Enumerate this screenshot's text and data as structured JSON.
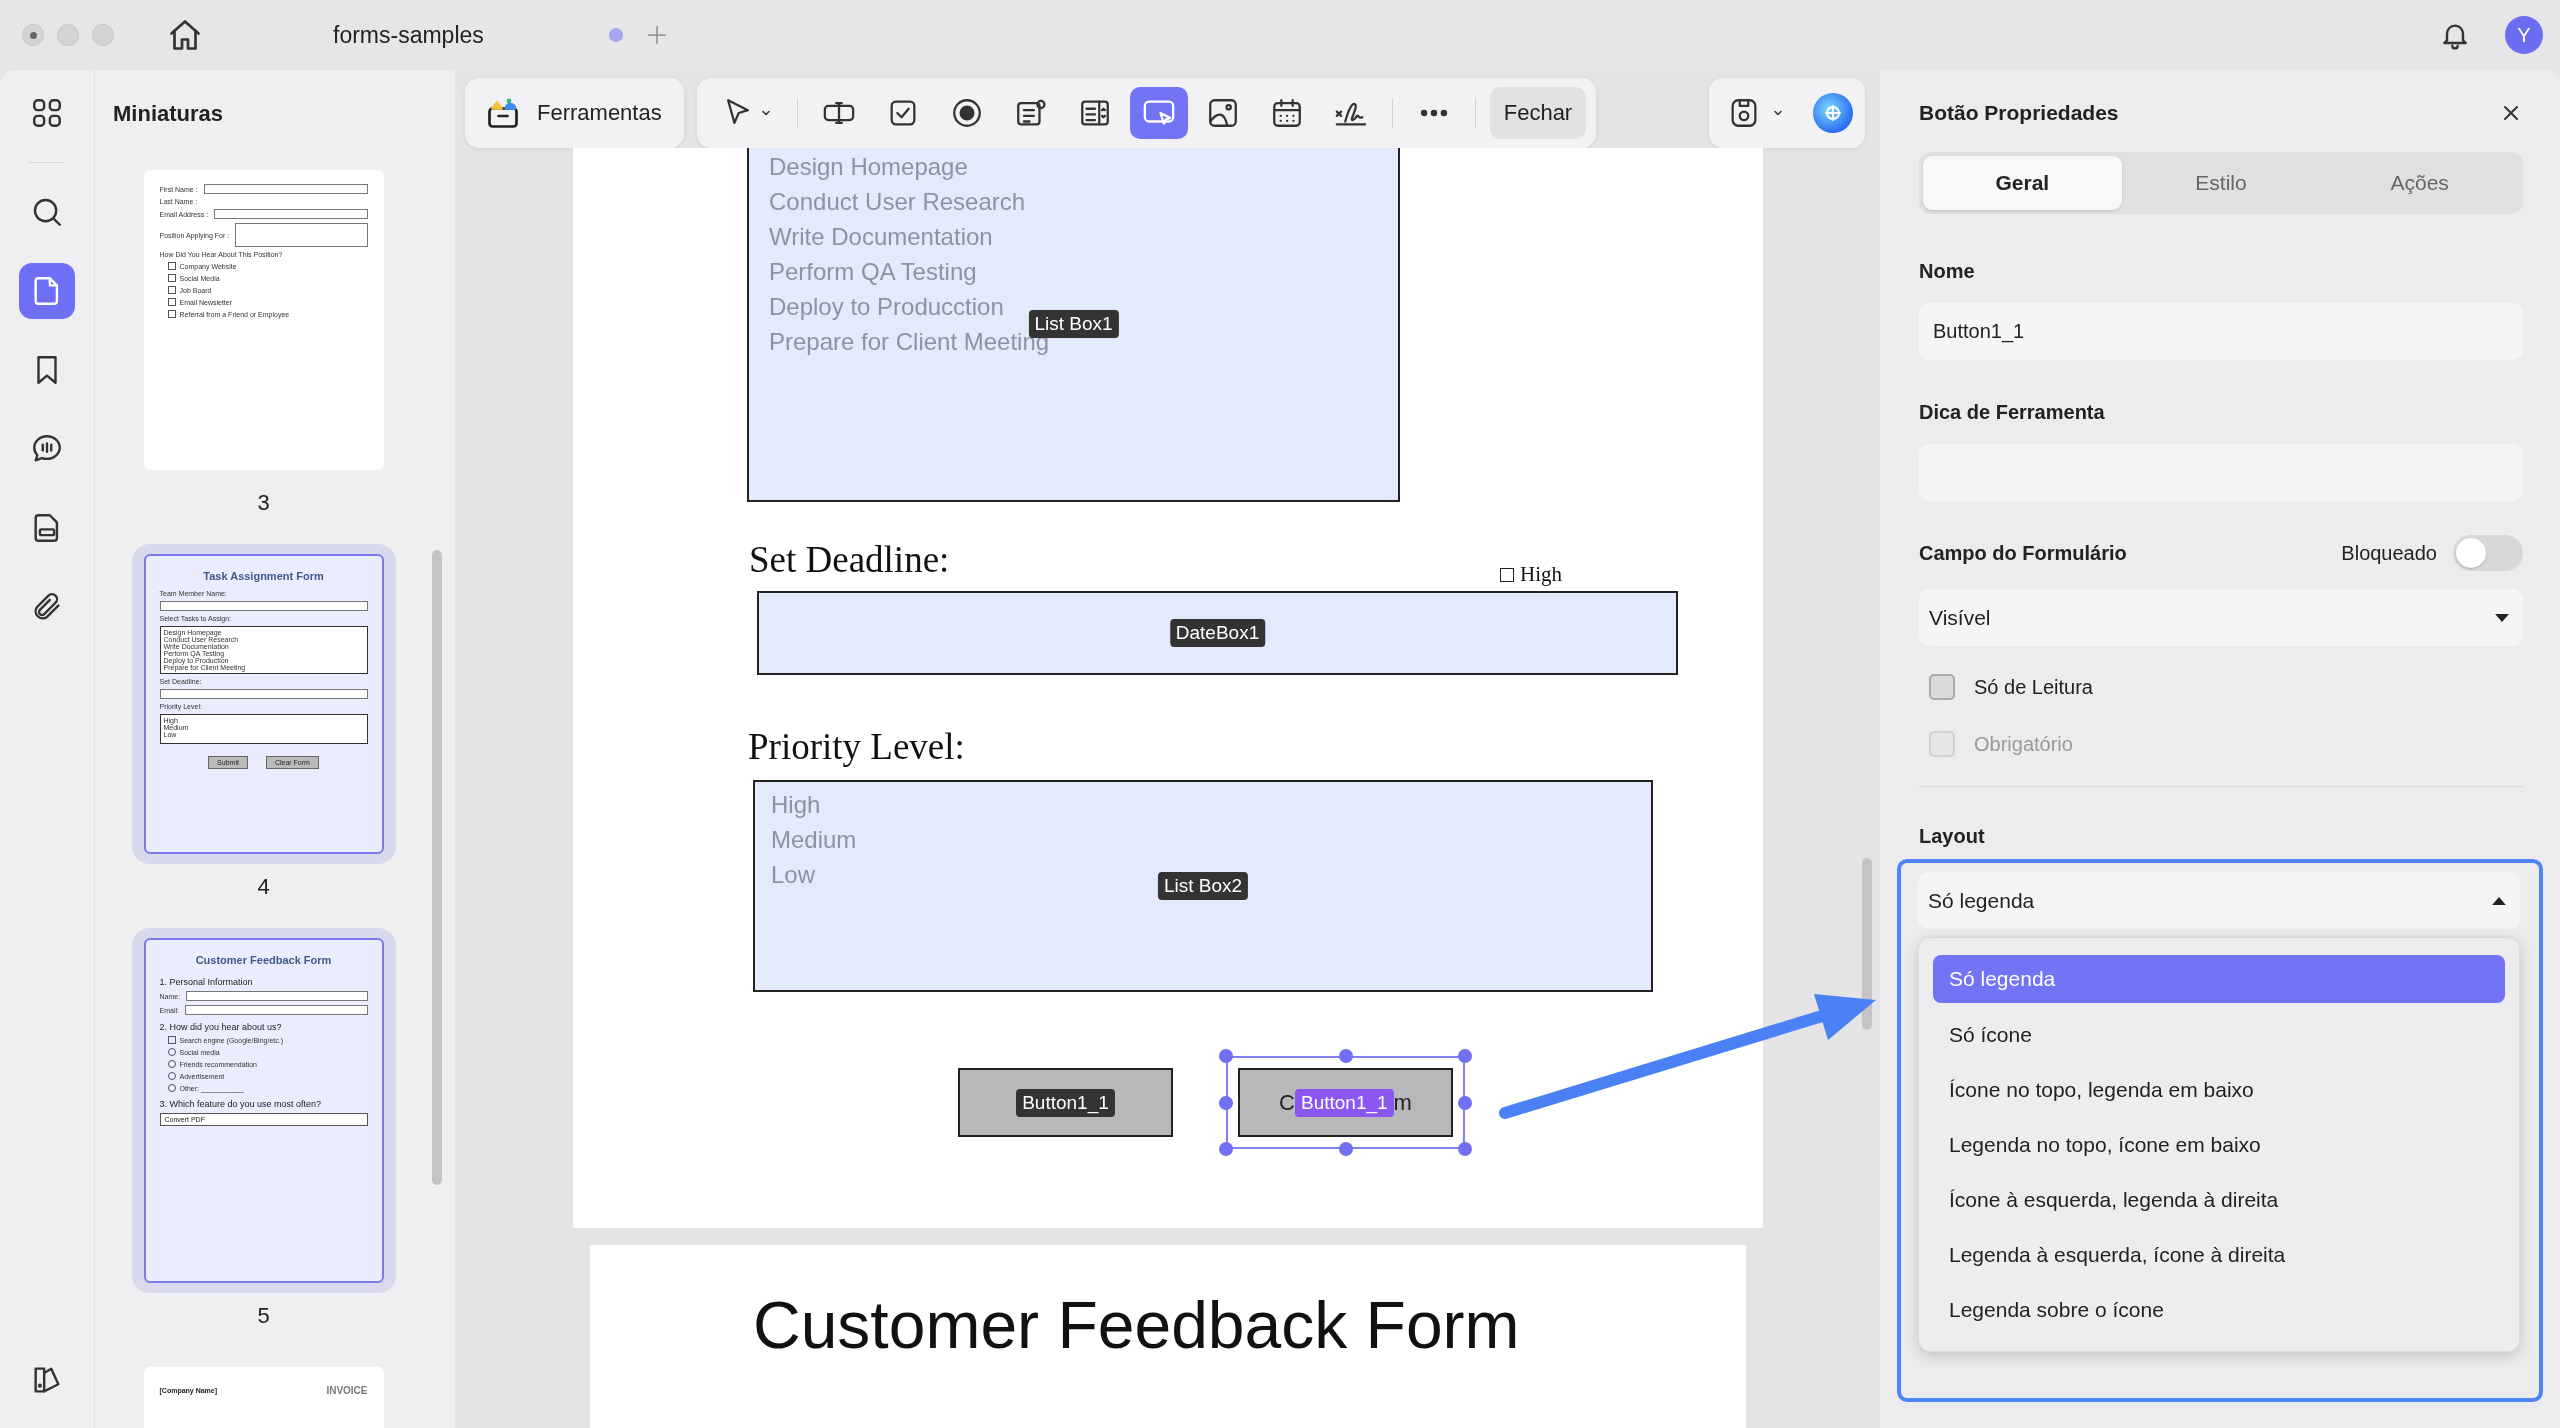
{
  "window": {
    "tab_title": "forms-samples",
    "tab_modified": true,
    "avatar_initial": "Y"
  },
  "rail": {
    "items": [
      {
        "selected": false
      },
      {
        "selected": false
      },
      {
        "selected": true
      },
      {
        "selected": false
      },
      {
        "selected": false
      },
      {
        "selected": false
      },
      {
        "selected": false
      }
    ]
  },
  "thumbnails": {
    "title": "Miniaturas",
    "pages": [
      {
        "page": "3",
        "selected": false,
        "lines": [
          {
            "kind": "labeled_field",
            "text": "First Name :"
          },
          {
            "kind": "label",
            "text": "Last Name :"
          },
          {
            "kind": "labeled_field",
            "text": "Email Address :"
          },
          {
            "kind": "labeled_area",
            "text": "Position Applying For :"
          },
          {
            "kind": "label",
            "text": "How Did You Hear About This Position?"
          },
          {
            "kind": "check",
            "text": "Company Website"
          },
          {
            "kind": "check",
            "text": "Social Media"
          },
          {
            "kind": "check",
            "text": "Job Board"
          },
          {
            "kind": "check",
            "text": "Email Newsletter"
          },
          {
            "kind": "check",
            "text": "Referral from a Friend or Employee"
          }
        ]
      },
      {
        "page": "4",
        "selected": true,
        "lines": [
          {
            "kind": "title",
            "text": "Task Assignment Form"
          },
          {
            "kind": "label",
            "text": "Team Member Name:"
          },
          {
            "kind": "field"
          },
          {
            "kind": "label",
            "text": "Select Tasks to Assign:"
          },
          {
            "kind": "list",
            "items": [
              "Design Homepage",
              "Conduct User Research",
              "Write Documentation",
              "Perform QA Testing",
              "Deploy to Production",
              "Prepare for Client Meeting"
            ]
          },
          {
            "kind": "label",
            "text": "Set Deadline:"
          },
          {
            "kind": "field"
          },
          {
            "kind": "label",
            "text": "Priority Level:"
          },
          {
            "kind": "list",
            "items": [
              "High",
              "Medium",
              "Low"
            ]
          },
          {
            "kind": "buttons",
            "items": [
              "Submit",
              "Clear Form"
            ]
          }
        ]
      },
      {
        "page": "5",
        "selected": true,
        "lines": [
          {
            "kind": "title",
            "text": "Customer Feedback Form"
          },
          {
            "kind": "heading",
            "text": "1. Personal Information"
          },
          {
            "kind": "labeled_field",
            "text": "Name:"
          },
          {
            "kind": "labeled_field",
            "text": "Email:"
          },
          {
            "kind": "heading",
            "text": "2. How did you hear about us?"
          },
          {
            "kind": "check",
            "text": "Search engine (Google/Bing/etc.)"
          },
          {
            "kind": "radio",
            "text": "Social media"
          },
          {
            "kind": "radio",
            "text": "Friends recommendation"
          },
          {
            "kind": "radio",
            "text": "Advertisement"
          },
          {
            "kind": "radio",
            "text": "Other: ___________"
          },
          {
            "kind": "heading",
            "text": "3. Which feature do you use most often?"
          },
          {
            "kind": "select",
            "text": "Convert PDF"
          }
        ]
      },
      {
        "selected": false,
        "lines": [
          {
            "kind": "pair",
            "left": "[Company Name]",
            "right": "INVOICE"
          }
        ]
      }
    ]
  },
  "toolbar": {
    "tools_label": "Ferramentas",
    "tools": [
      {
        "selected": false
      },
      {
        "selected": false
      },
      {
        "selected": false
      },
      {
        "selected": false
      },
      {
        "selected": false
      },
      {
        "selected": false
      },
      {
        "selected": true
      },
      {
        "selected": false
      },
      {
        "selected": false
      },
      {
        "selected": false
      }
    ],
    "close_label": "Fechar"
  },
  "document": {
    "list_box_1": {
      "items": [
        "Design Homepage",
        "Conduct User Research",
        "Write Documentation",
        "Perform QA Testing",
        "Deploy to Producction",
        "Prepare for Client Meeting"
      ],
      "tag": "List Box1"
    },
    "deadline": {
      "heading": "Set Deadline:",
      "checkbox_label": "High",
      "checked": false,
      "tag": "DateBox1"
    },
    "priority": {
      "heading": "Priority Level:",
      "items": [
        "High",
        "Medium",
        "Low"
      ],
      "tag": "List Box2"
    },
    "buttons": [
      {
        "tag": "Button1_1",
        "selected": false
      },
      {
        "tag": "Button1_1",
        "selected": true,
        "caption_parts": [
          "C",
          "m"
        ]
      }
    ],
    "next_page_title": "Customer Feedback Form"
  },
  "properties": {
    "title": "Botão Propriedades",
    "tabs": [
      {
        "label": "Geral",
        "selected": true
      },
      {
        "label": "Estilo",
        "selected": false
      },
      {
        "label": "Ações",
        "selected": false
      }
    ],
    "name": {
      "label": "Nome",
      "value": "Button1_1"
    },
    "tooltip": {
      "label": "Dica de Ferramenta"
    },
    "form_field": {
      "label": "Campo do Formulário",
      "lock_label": "Bloqueado",
      "locked": false,
      "visibility": "Visível"
    },
    "options": [
      {
        "label": "Só de Leitura",
        "checked": false,
        "disabled": false
      },
      {
        "label": "Obrigatório",
        "checked": false,
        "disabled": true
      }
    ],
    "layout": {
      "label": "Layout",
      "value": "Só legenda",
      "expanded": true,
      "options": [
        {
          "label": "Só legenda",
          "selected": true
        },
        {
          "label": "Só ícone",
          "selected": false
        },
        {
          "label": "Ícone no topo, legenda em baixo",
          "selected": false
        },
        {
          "label": "Legenda no topo, ícone em baixo",
          "selected": false
        },
        {
          "label": "Ícone à esquerda, legenda à direita",
          "selected": false
        },
        {
          "label": "Legenda à esquerda, ícone à direita",
          "selected": false
        },
        {
          "label": "Legenda sobre o ícone",
          "selected": false
        }
      ]
    }
  }
}
